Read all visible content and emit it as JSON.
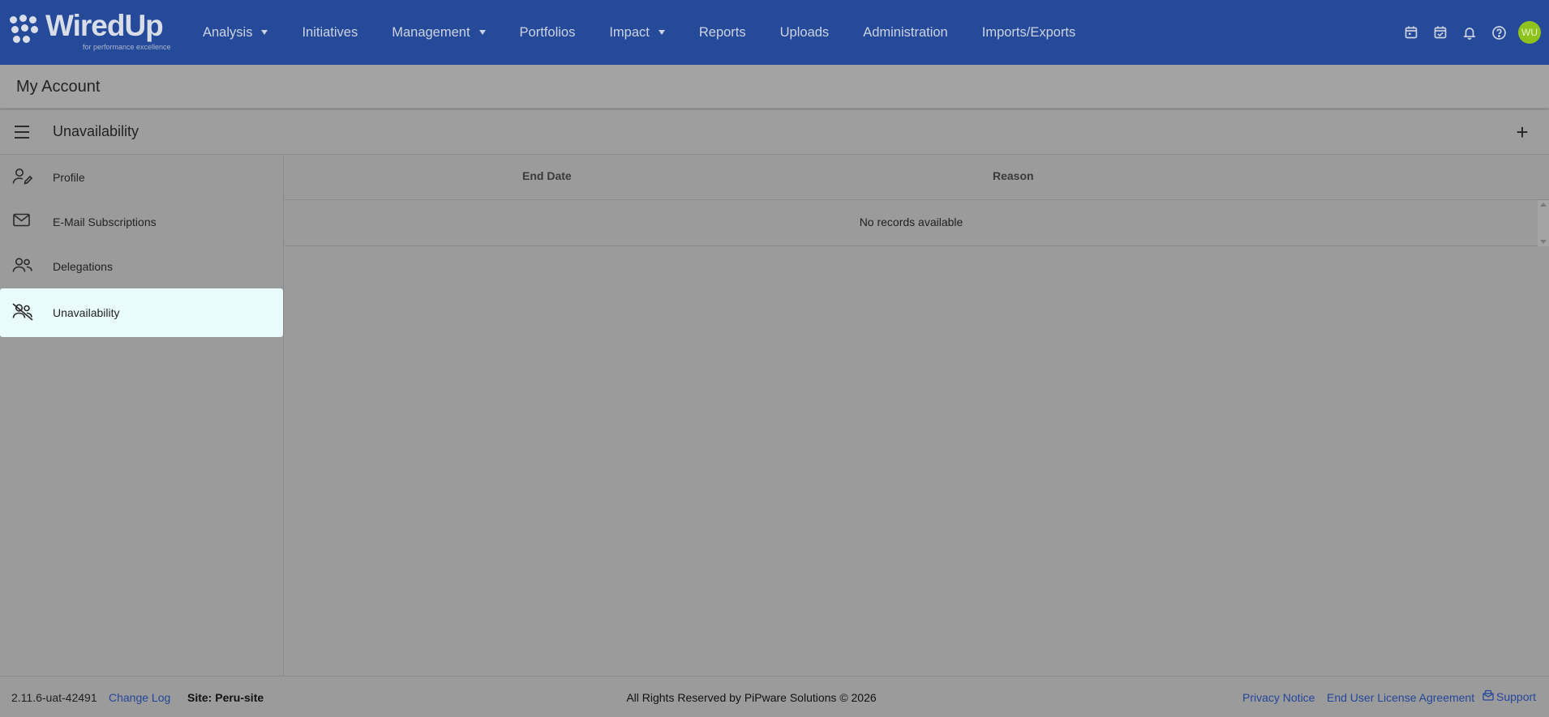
{
  "app": {
    "logo_text": "WiredUp",
    "logo_tagline": "for performance excellence",
    "avatar_initials": "WU",
    "colors": {
      "nav_bg": "#244a99",
      "accent_link": "#24469a",
      "avatar_bg": "#8ec21d",
      "active_item_bg": "#e9fbfb"
    }
  },
  "nav": {
    "items": [
      {
        "label": "Analysis",
        "has_dropdown": true
      },
      {
        "label": "Initiatives",
        "has_dropdown": false
      },
      {
        "label": "Management",
        "has_dropdown": true
      },
      {
        "label": "Portfolios",
        "has_dropdown": false
      },
      {
        "label": "Impact",
        "has_dropdown": true
      },
      {
        "label": "Reports",
        "has_dropdown": false
      },
      {
        "label": "Uploads",
        "has_dropdown": false
      },
      {
        "label": "Administration",
        "has_dropdown": false
      },
      {
        "label": "Imports/Exports",
        "has_dropdown": false
      }
    ],
    "icons": [
      "calendar-icon",
      "calendar-check-icon",
      "bell-icon",
      "help-icon"
    ]
  },
  "page": {
    "title": "My Account"
  },
  "section": {
    "title": "Unavailability",
    "add_symbol": "+"
  },
  "sidebar": {
    "items": [
      {
        "label": "Profile",
        "icon": "user-edit-icon",
        "active": false
      },
      {
        "label": "E-Mail Subscriptions",
        "icon": "mail-icon",
        "active": false
      },
      {
        "label": "Delegations",
        "icon": "users-icon",
        "active": false
      },
      {
        "label": "Unavailability",
        "icon": "users-off-icon",
        "active": true
      }
    ]
  },
  "grid": {
    "columns": [
      "End Date",
      "Reason"
    ],
    "empty_message": "No records available"
  },
  "footer": {
    "version": "2.11.6-uat-42491",
    "change_log": "Change Log",
    "site": "Site: Peru-site",
    "rights": "All Rights Reserved by PiPware Solutions © 2026",
    "privacy": "Privacy Notice",
    "eula": "End User License Agreement",
    "support": "Support"
  }
}
